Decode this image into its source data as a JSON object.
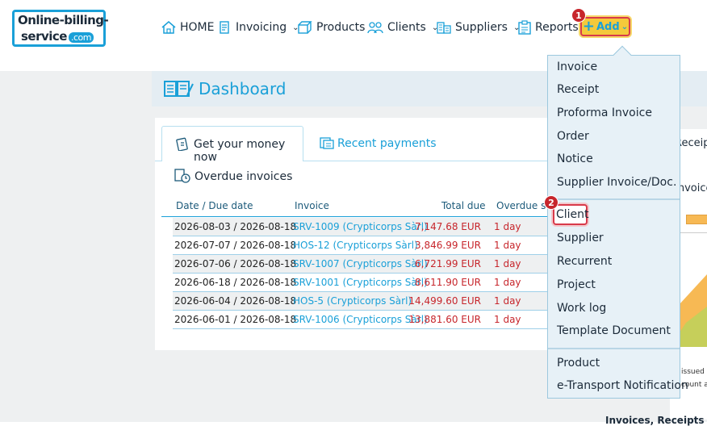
{
  "logo": {
    "line1": "Online-billing-",
    "line2": "service",
    "dotcom": ".com"
  },
  "nav": {
    "home": "HOME",
    "invoicing": "Invoicing",
    "products": "Products",
    "clients": "Clients",
    "suppliers": "Suppliers",
    "reports": "Reports",
    "add": "Add"
  },
  "badges": {
    "step1": "1",
    "step2": "2"
  },
  "dashboard": {
    "title": "Dashboard",
    "tab_active": "Get your money now",
    "tab_recent": "Recent payments",
    "section_title": "Overdue invoices",
    "columns": [
      "Date / Due date",
      "Invoice",
      "Total due",
      "Overdue since"
    ],
    "rows": [
      {
        "date": "2026-08-03 / 2026-08-18",
        "invoice": "SRV-1009 (Crypticorps Sàrl)",
        "total": "7,147.68 EUR",
        "overdue": "1 day"
      },
      {
        "date": "2026-07-07 / 2026-08-18",
        "invoice": "HOS-12 (Crypticorps Sàrl)",
        "total": "3,846.99 EUR",
        "overdue": "1 day"
      },
      {
        "date": "2026-07-06 / 2026-08-18",
        "invoice": "SRV-1007 (Crypticorps Sàrl)",
        "total": "6,721.99 EUR",
        "overdue": "1 day"
      },
      {
        "date": "2026-06-18 / 2026-08-18",
        "invoice": "SRV-1001 (Crypticorps Sàrl)",
        "total": "8,611.90 EUR",
        "overdue": "1 day"
      },
      {
        "date": "2026-06-04 / 2026-08-18",
        "invoice": "HOS-5 (Crypticorps Sàrl)",
        "total": "14,499.60 EUR",
        "overdue": "1 day"
      },
      {
        "date": "2026-06-01 / 2026-08-18",
        "invoice": "SRV-1006 (Crypticorps Sàrl)",
        "total": "13,881.60 EUR",
        "overdue": "1 day"
      }
    ]
  },
  "right_panel": {
    "receipts": "Receipts",
    "invoiced": "Invoiced",
    "issued": "issued and",
    "count": "count at the",
    "bottom_title": "Invoices, Receipts"
  },
  "add_menu": {
    "group1": [
      "Invoice",
      "Receipt",
      "Proforma Invoice",
      "Order",
      "Notice",
      "Supplier Invoice/Doc."
    ],
    "group2": [
      "Client",
      "Supplier",
      "Recurrent",
      "Project",
      "Work log",
      "Template Document"
    ],
    "group3": [
      "Product",
      "e-Transport Notification"
    ]
  },
  "colors": {
    "accent": "#1aa0d8",
    "highlight": "#d83a4a",
    "add_button": "#f4c93b",
    "overdue": "#c7262c"
  }
}
